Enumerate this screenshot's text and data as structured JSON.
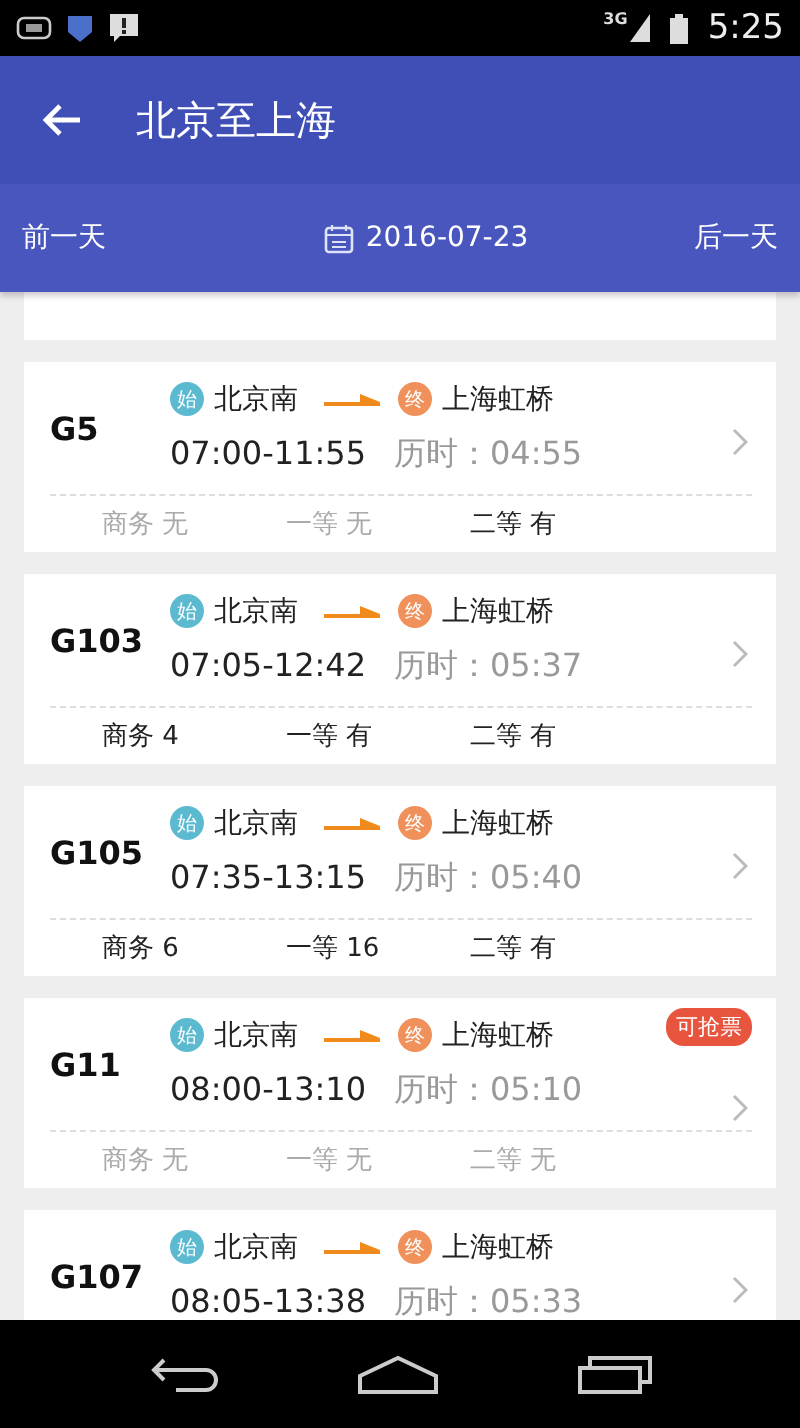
{
  "status_bar": {
    "network": "3G",
    "time": "5:25"
  },
  "app_bar": {
    "title": "北京至上海"
  },
  "date_bar": {
    "prev": "前一天",
    "date": "2016-07-23",
    "next": "后一天"
  },
  "trains": [
    {
      "number": "G5",
      "from_mark": "始",
      "from": "北京南",
      "to_mark": "终",
      "to": "上海虹桥",
      "times": "07:00-11:55",
      "duration": "历时：04:55",
      "seats": [
        {
          "label": "商务 无",
          "available": false
        },
        {
          "label": "一等 无",
          "available": false
        },
        {
          "label": "二等 有",
          "available": true
        }
      ]
    },
    {
      "number": "G103",
      "from_mark": "始",
      "from": "北京南",
      "to_mark": "终",
      "to": "上海虹桥",
      "times": "07:05-12:42",
      "duration": "历时：05:37",
      "seats": [
        {
          "label": "商务 4",
          "available": true
        },
        {
          "label": "一等 有",
          "available": true
        },
        {
          "label": "二等 有",
          "available": true
        }
      ]
    },
    {
      "number": "G105",
      "from_mark": "始",
      "from": "北京南",
      "to_mark": "终",
      "to": "上海虹桥",
      "times": "07:35-13:15",
      "duration": "历时：05:40",
      "seats": [
        {
          "label": "商务 6",
          "available": true
        },
        {
          "label": "一等 16",
          "available": true
        },
        {
          "label": "二等 有",
          "available": true
        }
      ]
    },
    {
      "number": "G11",
      "from_mark": "始",
      "from": "北京南",
      "to_mark": "终",
      "to": "上海虹桥",
      "times": "08:00-13:10",
      "duration": "历时：05:10",
      "badge": "可抢票",
      "seats": [
        {
          "label": "商务 无",
          "available": false
        },
        {
          "label": "一等 无",
          "available": false
        },
        {
          "label": "二等 无",
          "available": false
        }
      ]
    },
    {
      "number": "G107",
      "from_mark": "始",
      "from": "北京南",
      "to_mark": "终",
      "to": "上海虹桥",
      "times": "08:05-13:38",
      "duration": "历时：05:33"
    }
  ]
}
